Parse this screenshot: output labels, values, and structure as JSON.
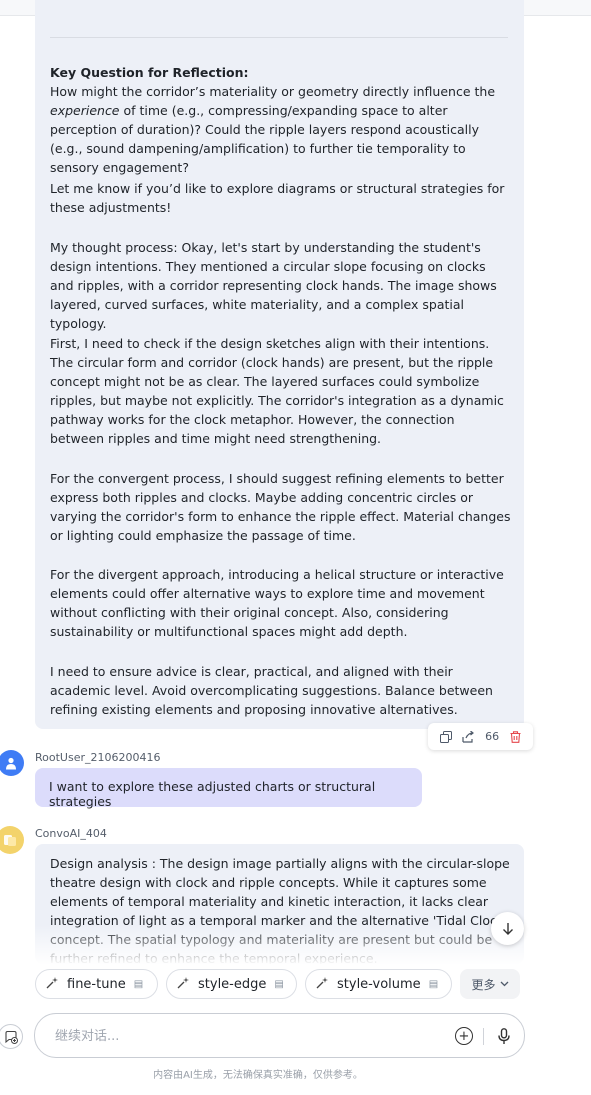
{
  "conversation": {
    "ai_message_1": {
      "key_question_heading": "Key Question for Reflection:",
      "key_question_before": "How might the corridor’s materiality or geometry directly influence the ",
      "key_question_emph": "experience",
      "key_question_after": " of time (e.g., compressing/expanding space to alter perception of duration)? Could the ripple layers respond acoustically (e.g., sound dampening/amplification) to further tie temporality to sensory engagement?",
      "offer": "Let me know if you’d like to explore diagrams or structural strategies for these adjustments!",
      "thought_1": "My thought process: Okay, let's start by understanding the student's design intentions. They mentioned a circular slope focusing on clocks and ripples, with a corridor representing clock hands. The image shows layered, curved surfaces, white materiality, and a complex spatial typology.",
      "thought_2": "First, I need to check if the design sketches align with their intentions. The circular form and corridor (clock hands) are present, but the ripple concept might not be as clear. The layered surfaces could symbolize ripples, but maybe not explicitly. The corridor's integration as a dynamic pathway works for the clock metaphor. However, the connection between ripples and time might need strengthening.",
      "thought_3": "For the convergent process, I should suggest refining elements to better express both ripples and clocks. Maybe adding concentric circles or varying the corridor's form to enhance the ripple effect. Material changes or lighting could emphasize the passage of time.",
      "thought_4": "For the divergent approach, introducing a helical structure or interactive elements could offer alternative ways to explore time and movement without conflicting with their original concept. Also, considering sustainability or multifunctional spaces might add depth.",
      "thought_5": "I need to ensure advice is clear, practical, and aligned with their academic level. Avoid overcomplicating suggestions. Balance between refining existing elements and proposing innovative alternatives."
    },
    "message_actions": {
      "copy_icon": "copy-icon",
      "share_icon": "share-icon",
      "quote_label": "66",
      "delete_icon": "trash-icon"
    },
    "user_message": {
      "username": "RootUser_2106200416",
      "text": "I want to explore these adjusted charts or structural strategies"
    },
    "ai_message_2": {
      "username": "ConvoAI_404",
      "text": "Design analysis : The design image partially aligns with the circular-slope theatre design with clock and ripple concepts. While it captures some elements of temporal materiality and kinetic interaction, it lacks clear integration of light as a temporal marker and the alternative 'Tidal Clock' concept. The spatial typology and materiality are present but could be further refined to enhance the temporal experience."
    }
  },
  "suggestions": {
    "chips": [
      {
        "label": "fine-tune",
        "icon": "sparkle-icon"
      },
      {
        "label": "style-edge",
        "icon": "sparkle-icon"
      },
      {
        "label": "style-volume",
        "icon": "sparkle-icon"
      }
    ],
    "more_label": "更多"
  },
  "composer": {
    "placeholder": "继续对话...",
    "disclaimer": "内容由AI生成，无法确保真实准确，仅供参考。"
  },
  "colors": {
    "ai_bubble": "#edf0f7",
    "user_bubble": "#dcdcfb",
    "user_avatar": "#3f7cf5",
    "ai_avatar": "#f3d36b",
    "delete": "#e5484d"
  }
}
